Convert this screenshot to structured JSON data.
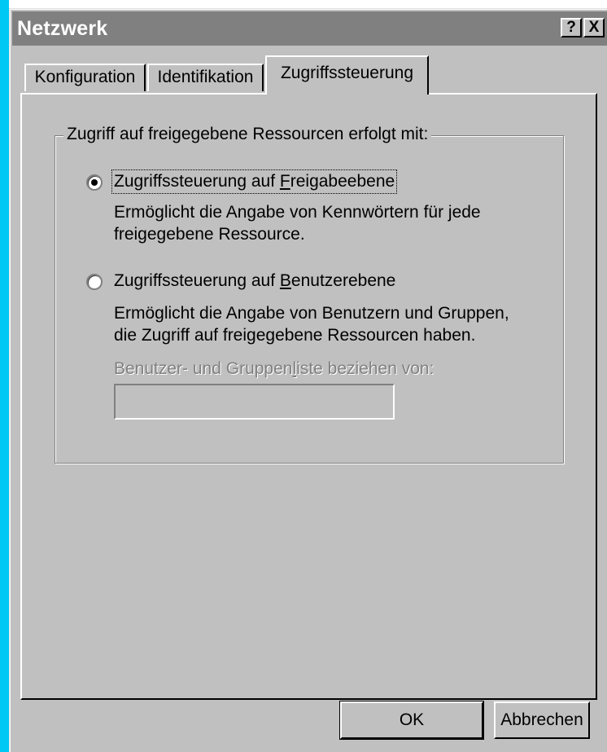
{
  "window": {
    "title": "Netzwerk",
    "help_label": "?",
    "close_label": "X"
  },
  "tabs": [
    {
      "label": "Konfiguration"
    },
    {
      "label": "Identifikation"
    },
    {
      "label": "Zugriffssteuerung"
    }
  ],
  "group": {
    "legend": "Zugriff auf freigegebene Ressourcen erfolgt mit:",
    "option1": {
      "label_prefix": "Zugriffssteuerung auf ",
      "label_accel": "F",
      "label_suffix": "reigabeebene",
      "selected": true,
      "desc_line1": "Ermöglicht die Angabe von Kennwörtern für jede",
      "desc_line2": "freigegebene Ressource."
    },
    "option2": {
      "label_prefix": "Zugriffssteuerung auf ",
      "label_accel": "B",
      "label_suffix": "enutzerebene",
      "selected": false,
      "desc_line1": "Ermöglicht die Angabe von Benutzern und Gruppen,",
      "desc_line2": "die Zugriff auf freigegebene Ressourcen haben."
    },
    "source_label_prefix": "Benutzer- und Gruppen",
    "source_label_accel": "l",
    "source_label_suffix": "iste beziehen von:",
    "source_value": ""
  },
  "buttons": {
    "ok": "OK",
    "cancel": "Abbrechen"
  },
  "colors": {
    "face": "#c0c0c0",
    "title_inactive": "#808080",
    "desktop_strip": "#00c8f4"
  }
}
